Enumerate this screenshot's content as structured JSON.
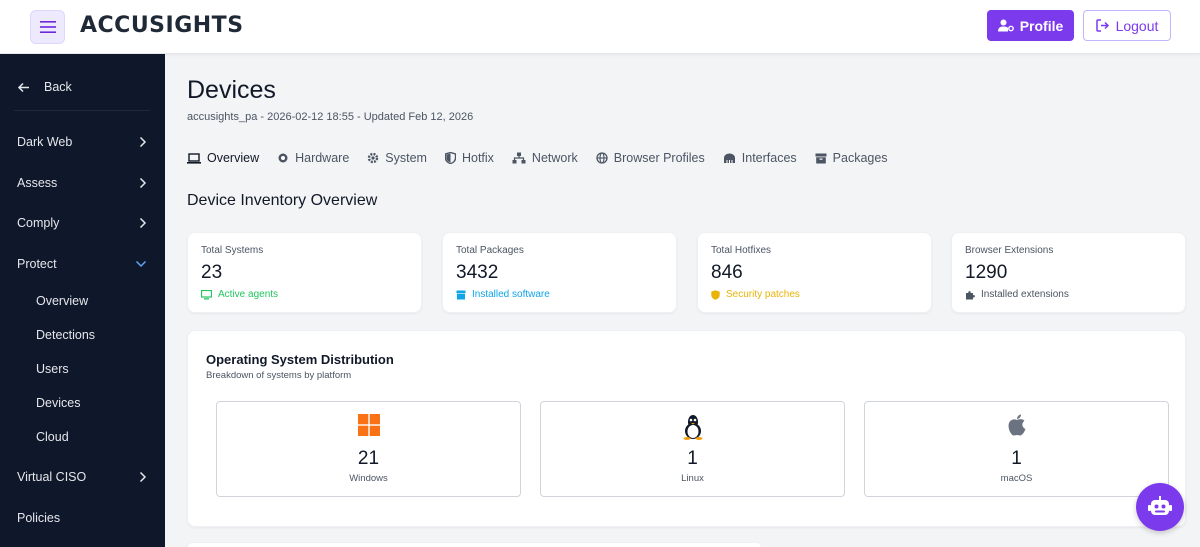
{
  "header": {
    "brand": "ACCUSIGHTS",
    "profile_label": "Profile",
    "logout_label": "Logout"
  },
  "sidebar": {
    "back_label": "Back",
    "items": [
      {
        "label": "Dark Web"
      },
      {
        "label": "Assess"
      },
      {
        "label": "Comply"
      },
      {
        "label": "Protect"
      },
      {
        "label": "Virtual CISO"
      },
      {
        "label": "Policies"
      }
    ],
    "protect_sub": [
      {
        "label": "Overview"
      },
      {
        "label": "Detections"
      },
      {
        "label": "Users"
      },
      {
        "label": "Devices"
      },
      {
        "label": "Cloud"
      }
    ]
  },
  "main": {
    "title": "Devices",
    "subtitle": "accusights_pa - 2026-02-12 18:55 - Updated Feb 12, 2026",
    "tabs": [
      {
        "label": "Overview"
      },
      {
        "label": "Hardware"
      },
      {
        "label": "System"
      },
      {
        "label": "Hotfix"
      },
      {
        "label": "Network"
      },
      {
        "label": "Browser Profiles"
      },
      {
        "label": "Interfaces"
      },
      {
        "label": "Packages"
      }
    ],
    "section_title": "Device Inventory Overview",
    "stats": [
      {
        "label": "Total Systems",
        "value": "23",
        "foot": "Active agents",
        "color": "#22c55e",
        "icon": "monitor-icon"
      },
      {
        "label": "Total Packages",
        "value": "3432",
        "foot": "Installed software",
        "color": "#0ea5e9",
        "icon": "package-icon"
      },
      {
        "label": "Total Hotfixes",
        "value": "846",
        "foot": "Security patches",
        "color": "#eab308",
        "icon": "shield-icon"
      },
      {
        "label": "Browser Extensions",
        "value": "1290",
        "foot": "Installed extensions",
        "color": "#4b5563",
        "icon": "puzzle-icon"
      }
    ],
    "os_distribution": {
      "title": "Operating System Distribution",
      "subtitle": "Breakdown of systems by platform",
      "items": [
        {
          "name": "Windows",
          "count": "21",
          "icon": "windows-icon",
          "color": "#f97316"
        },
        {
          "name": "Linux",
          "count": "1",
          "icon": "linux-icon",
          "color": "#111827"
        },
        {
          "name": "macOS",
          "count": "1",
          "icon": "apple-icon",
          "color": "#6b7280"
        }
      ]
    }
  },
  "colors": {
    "accent": "#7c3aed",
    "sidebar_bg": "#0f172a"
  }
}
